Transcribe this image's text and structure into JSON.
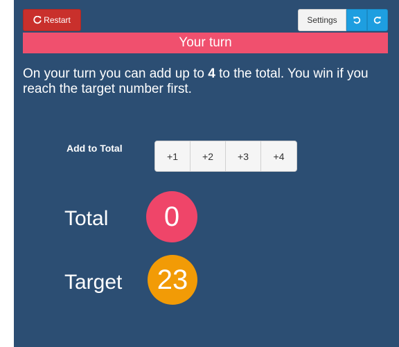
{
  "toolbar": {
    "restart_label": "Restart",
    "settings_label": "Settings"
  },
  "status": {
    "text": "Your turn"
  },
  "instructions": {
    "part1": "On your turn you can add up to ",
    "max_add": "4",
    "part2": " to the total. You win if you reach the target number first."
  },
  "add": {
    "label": "Add to Total",
    "options": [
      "+1",
      "+2",
      "+3",
      "+4"
    ]
  },
  "total": {
    "label": "Total",
    "value": "0"
  },
  "target": {
    "label": "Target",
    "value": "23"
  },
  "colors": {
    "background": "#2c4e73",
    "restart": "#c9302c",
    "status_bar": "#f0506e",
    "total_circle": "#ef4569",
    "target_circle": "#f29b06",
    "undo_redo": "#1e9ee0"
  },
  "icons": {
    "restart": "refresh-icon",
    "undo": "undo-icon",
    "redo": "redo-icon"
  }
}
